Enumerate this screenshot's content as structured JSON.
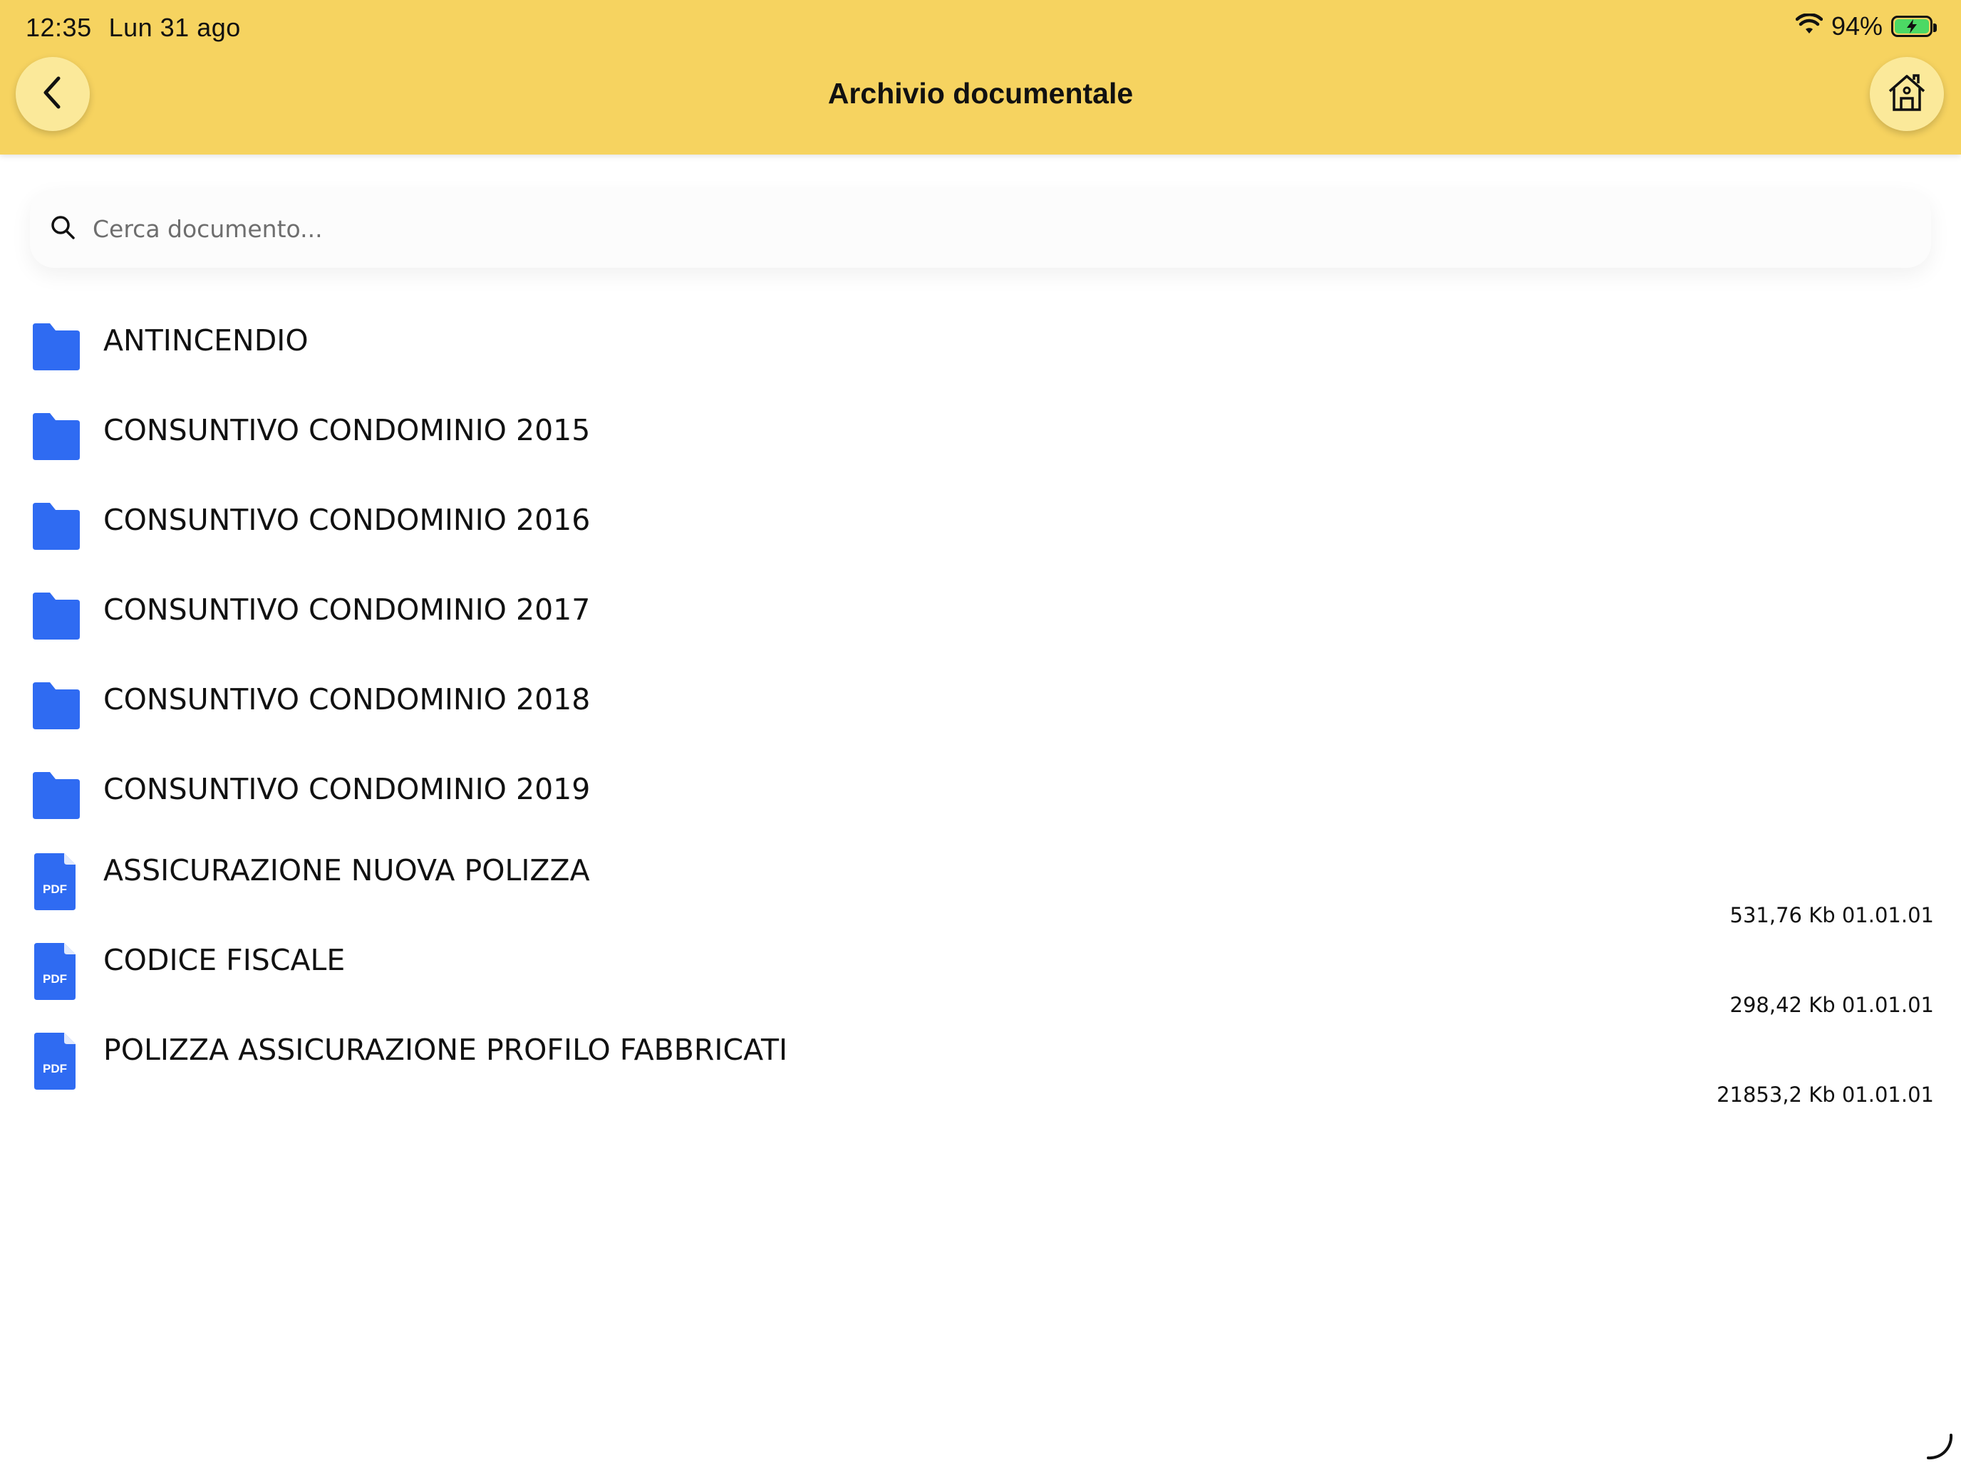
{
  "status_bar": {
    "time": "12:35",
    "date": "Lun 31 ago",
    "battery_percent": "94%",
    "battery_level": 0.94
  },
  "header": {
    "title": "Archivio documentale",
    "back_icon": "chevron-left-icon",
    "home_icon": "home-icon"
  },
  "search": {
    "placeholder": "Cerca documento..."
  },
  "folders": [
    {
      "name": "ANTINCENDIO"
    },
    {
      "name": "CONSUNTIVO CONDOMINIO 2015"
    },
    {
      "name": "CONSUNTIVO CONDOMINIO 2016"
    },
    {
      "name": "CONSUNTIVO CONDOMINIO 2017"
    },
    {
      "name": "CONSUNTIVO CONDOMINIO 2018"
    },
    {
      "name": "CONSUNTIVO CONDOMINIO 2019"
    }
  ],
  "files": [
    {
      "name": "ASSICURAZIONE NUOVA POLIZZA",
      "meta": "531,76 Kb 01.01.01",
      "type": "PDF"
    },
    {
      "name": "CODICE FISCALE",
      "meta": "298,42 Kb 01.01.01",
      "type": "PDF"
    },
    {
      "name": "POLIZZA ASSICURAZIONE PROFILO FABBRICATI",
      "meta": "21853,2 Kb 01.01.01",
      "type": "PDF"
    }
  ],
  "colors": {
    "header": "#f6d360",
    "button": "#fbe99a",
    "icon_blue": "#2f6bf2"
  }
}
